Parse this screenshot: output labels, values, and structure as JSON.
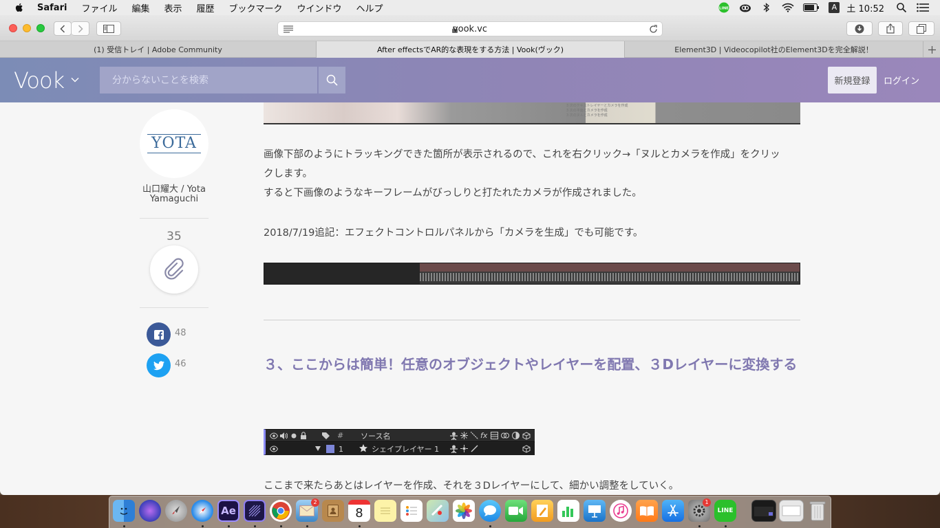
{
  "menubar": {
    "app_name": "Safari",
    "items": [
      "ファイル",
      "編集",
      "表示",
      "履歴",
      "ブックマーク",
      "ウインドウ",
      "ヘルプ"
    ],
    "ime": "A",
    "clock": "土 10:52",
    "status_icons": [
      "line-icon",
      "creative-cloud-icon",
      "bluetooth-icon",
      "wifi-icon",
      "battery-icon",
      "input-source-icon",
      "spotlight-icon",
      "notification-center-icon"
    ]
  },
  "browser": {
    "url": "vook.vc",
    "tabs": [
      {
        "label": "(1) 受信トレイ | Adobe Community",
        "active": false
      },
      {
        "label": "After effectsでAR的な表現をする方法 | Vook(ヴック)",
        "active": true
      },
      {
        "label": "Element3D | Videocopilot社のElement3Dを完全解説！",
        "active": false
      }
    ]
  },
  "site": {
    "logo": "Vook",
    "search_placeholder": "分からないことを検索",
    "signup": "新規登録",
    "login": "ログイン"
  },
  "sidebar": {
    "avatar_text": "YOTA",
    "author_name": "山口耀大 / Yota Yamaguchi",
    "clip_count": "35",
    "facebook_count": "48",
    "twitter_count": "46"
  },
  "article": {
    "img_caption_lines": [
      "3 次のテキストレイヤーとカメラを作成",
      "3 次の平面とカメラを作成",
      "3 次のヌルとカメラを作成"
    ],
    "para1_line1": "画像下部のようにトラッキングできた箇所が表示されるので、これを右クリック→「ヌルとカメラを作成」をクリッ",
    "para1_line2": "クします。",
    "para1_line3": "すると下画像のようなキーフレームがびっしりと打たれたカメラが作成されました。",
    "para2": "2018/7/19追記：エフェクトコントロルパネルから「カメラを生成」でも可能です。",
    "section_title": "３、ここからは簡単！任意のオブジェクトやレイヤーを配置、３Dレイヤーに変換する",
    "ae_header_hash": "#",
    "ae_header_source": "ソース名",
    "ae_layer_num": "1",
    "ae_layer_name": "シェイプレイヤー 1",
    "para3": "ここまで来たらあとはレイヤーを作成、それを３Dレイヤーにして、細かい調整をしていく。"
  },
  "dock": {
    "calendar_day": "8",
    "mail_badge": "2",
    "prefs_badge": "1",
    "ae_label": "Ae"
  }
}
